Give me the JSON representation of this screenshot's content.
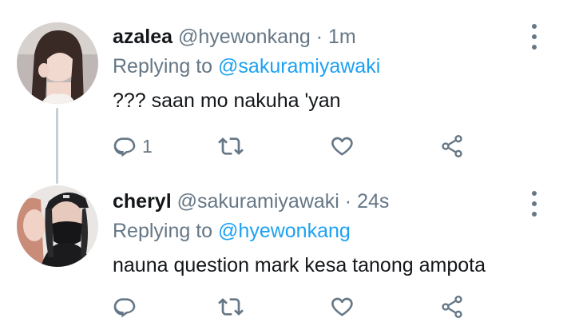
{
  "tweets": [
    {
      "name": "azalea",
      "handle": "@hyewonkang",
      "separator": "·",
      "time": "1m",
      "replying_prefix": "Replying to",
      "replying_to": "@sakuramiyawaki",
      "text": "??? saan mo nakuha 'yan",
      "reply_count": "1",
      "retweet_count": "",
      "like_count": ""
    },
    {
      "name": "cheryl",
      "handle": "@sakuramiyawaki",
      "separator": "·",
      "time": "24s",
      "replying_prefix": "Replying to",
      "replying_to": "@hyewonkang",
      "text": "nauna question mark kesa tanong ampota",
      "reply_count": "",
      "retweet_count": "",
      "like_count": ""
    }
  ],
  "colors": {
    "text": "#14171a",
    "secondary": "#657786",
    "link": "#1da1f2",
    "thread_line": "#c4cfd6"
  },
  "icons": {
    "reply": "reply-icon",
    "retweet": "retweet-icon",
    "like": "heart-icon",
    "share": "share-icon",
    "more": "more-vertical-icon"
  }
}
